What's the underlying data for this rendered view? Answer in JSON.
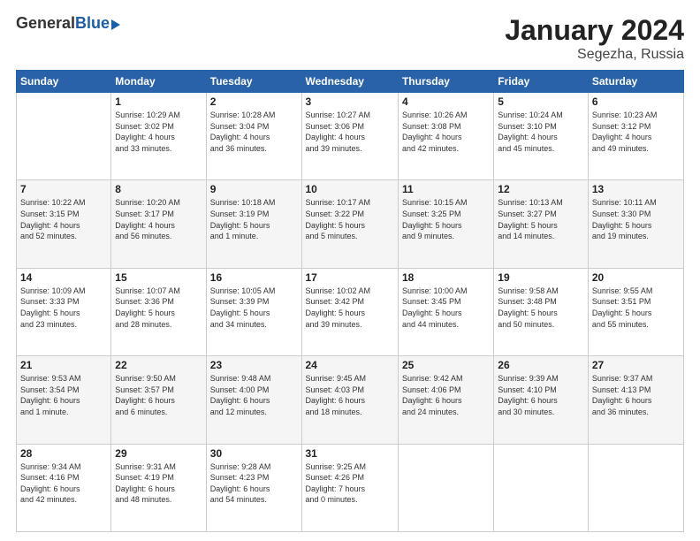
{
  "logo": {
    "general": "General",
    "blue": "Blue"
  },
  "header": {
    "month": "January 2024",
    "location": "Segezha, Russia"
  },
  "weekdays": [
    "Sunday",
    "Monday",
    "Tuesday",
    "Wednesday",
    "Thursday",
    "Friday",
    "Saturday"
  ],
  "weeks": [
    [
      {
        "day": "",
        "info": ""
      },
      {
        "day": "1",
        "info": "Sunrise: 10:29 AM\nSunset: 3:02 PM\nDaylight: 4 hours\nand 33 minutes."
      },
      {
        "day": "2",
        "info": "Sunrise: 10:28 AM\nSunset: 3:04 PM\nDaylight: 4 hours\nand 36 minutes."
      },
      {
        "day": "3",
        "info": "Sunrise: 10:27 AM\nSunset: 3:06 PM\nDaylight: 4 hours\nand 39 minutes."
      },
      {
        "day": "4",
        "info": "Sunrise: 10:26 AM\nSunset: 3:08 PM\nDaylight: 4 hours\nand 42 minutes."
      },
      {
        "day": "5",
        "info": "Sunrise: 10:24 AM\nSunset: 3:10 PM\nDaylight: 4 hours\nand 45 minutes."
      },
      {
        "day": "6",
        "info": "Sunrise: 10:23 AM\nSunset: 3:12 PM\nDaylight: 4 hours\nand 49 minutes."
      }
    ],
    [
      {
        "day": "7",
        "info": "Sunrise: 10:22 AM\nSunset: 3:15 PM\nDaylight: 4 hours\nand 52 minutes."
      },
      {
        "day": "8",
        "info": "Sunrise: 10:20 AM\nSunset: 3:17 PM\nDaylight: 4 hours\nand 56 minutes."
      },
      {
        "day": "9",
        "info": "Sunrise: 10:18 AM\nSunset: 3:19 PM\nDaylight: 5 hours\nand 1 minute."
      },
      {
        "day": "10",
        "info": "Sunrise: 10:17 AM\nSunset: 3:22 PM\nDaylight: 5 hours\nand 5 minutes."
      },
      {
        "day": "11",
        "info": "Sunrise: 10:15 AM\nSunset: 3:25 PM\nDaylight: 5 hours\nand 9 minutes."
      },
      {
        "day": "12",
        "info": "Sunrise: 10:13 AM\nSunset: 3:27 PM\nDaylight: 5 hours\nand 14 minutes."
      },
      {
        "day": "13",
        "info": "Sunrise: 10:11 AM\nSunset: 3:30 PM\nDaylight: 5 hours\nand 19 minutes."
      }
    ],
    [
      {
        "day": "14",
        "info": "Sunrise: 10:09 AM\nSunset: 3:33 PM\nDaylight: 5 hours\nand 23 minutes."
      },
      {
        "day": "15",
        "info": "Sunrise: 10:07 AM\nSunset: 3:36 PM\nDaylight: 5 hours\nand 28 minutes."
      },
      {
        "day": "16",
        "info": "Sunrise: 10:05 AM\nSunset: 3:39 PM\nDaylight: 5 hours\nand 34 minutes."
      },
      {
        "day": "17",
        "info": "Sunrise: 10:02 AM\nSunset: 3:42 PM\nDaylight: 5 hours\nand 39 minutes."
      },
      {
        "day": "18",
        "info": "Sunrise: 10:00 AM\nSunset: 3:45 PM\nDaylight: 5 hours\nand 44 minutes."
      },
      {
        "day": "19",
        "info": "Sunrise: 9:58 AM\nSunset: 3:48 PM\nDaylight: 5 hours\nand 50 minutes."
      },
      {
        "day": "20",
        "info": "Sunrise: 9:55 AM\nSunset: 3:51 PM\nDaylight: 5 hours\nand 55 minutes."
      }
    ],
    [
      {
        "day": "21",
        "info": "Sunrise: 9:53 AM\nSunset: 3:54 PM\nDaylight: 6 hours\nand 1 minute."
      },
      {
        "day": "22",
        "info": "Sunrise: 9:50 AM\nSunset: 3:57 PM\nDaylight: 6 hours\nand 6 minutes."
      },
      {
        "day": "23",
        "info": "Sunrise: 9:48 AM\nSunset: 4:00 PM\nDaylight: 6 hours\nand 12 minutes."
      },
      {
        "day": "24",
        "info": "Sunrise: 9:45 AM\nSunset: 4:03 PM\nDaylight: 6 hours\nand 18 minutes."
      },
      {
        "day": "25",
        "info": "Sunrise: 9:42 AM\nSunset: 4:06 PM\nDaylight: 6 hours\nand 24 minutes."
      },
      {
        "day": "26",
        "info": "Sunrise: 9:39 AM\nSunset: 4:10 PM\nDaylight: 6 hours\nand 30 minutes."
      },
      {
        "day": "27",
        "info": "Sunrise: 9:37 AM\nSunset: 4:13 PM\nDaylight: 6 hours\nand 36 minutes."
      }
    ],
    [
      {
        "day": "28",
        "info": "Sunrise: 9:34 AM\nSunset: 4:16 PM\nDaylight: 6 hours\nand 42 minutes."
      },
      {
        "day": "29",
        "info": "Sunrise: 9:31 AM\nSunset: 4:19 PM\nDaylight: 6 hours\nand 48 minutes."
      },
      {
        "day": "30",
        "info": "Sunrise: 9:28 AM\nSunset: 4:23 PM\nDaylight: 6 hours\nand 54 minutes."
      },
      {
        "day": "31",
        "info": "Sunrise: 9:25 AM\nSunset: 4:26 PM\nDaylight: 7 hours\nand 0 minutes."
      },
      {
        "day": "",
        "info": ""
      },
      {
        "day": "",
        "info": ""
      },
      {
        "day": "",
        "info": ""
      }
    ]
  ]
}
